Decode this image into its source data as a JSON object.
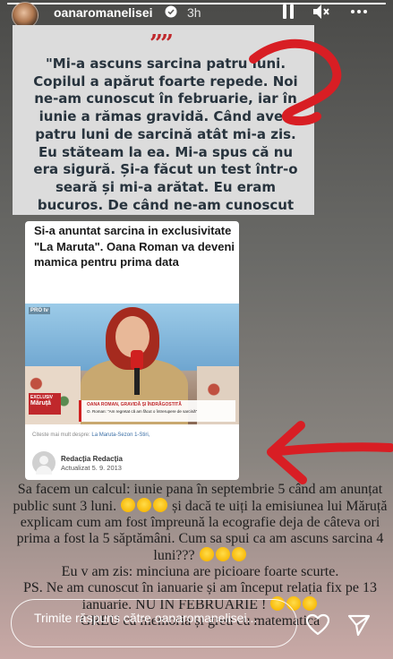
{
  "header": {
    "username": "oanaromanelisei",
    "timestamp": "3h",
    "progress": 1.0
  },
  "quote": {
    "mark": "””",
    "text": "\"Mi-a ascuns sarcina patru luni. Copilul a apărut foarte repede. Noi ne-am cunoscut în februarie, iar în iunie a rămas gravidă. Când avea patru luni de sarcină atât mi-a zis. Eu stăteam la ea. Mi-a spus că nu era sigură. Și-a făcut un test într-o seară și mi-a arătat. Eu eram bucuros. De când ne-am cunoscut"
  },
  "article": {
    "title": "Si-a anuntat sarcina in exclusivitate \"La Maruta\". Oana Roman va deveni mamica pentru prima data",
    "tv_brand": "PRO tv",
    "badge_line1": "EXCLUSIV",
    "badge_line2": "Măruță",
    "lower_third_headline": "OANA ROMAN, GRAVIDĂ ȘI ÎNDRĂGOSTITĂ",
    "lower_third_quote": "O. Roman: \"Am regretat că am făcut o întrerupere de sarcină\"",
    "more_label": "Citeste mai mult despre:",
    "more_tags": "La Maruta-Sezon 1-Stiri,",
    "author": "Redacția Redacția",
    "updated": "Actualizat 5. 9. 2013"
  },
  "caption": {
    "line1a": "Sa facem un calcul: iunie pana în septembrie 5 când am anunțat public sunt 3 luni.",
    "line1b": "și dacă te uiți la emisiunea lui Măruță explicam cum am fost împreună la ecografie deja de câteva ori  prima a fost la 5 săptămâni. Cum sa spui ca am ascuns sarcina 4 luni???",
    "line2": "Eu v am zis: minciuna are picioare foarte scurte.",
    "line3a": "PS. Ne am cunoscut în ianuarie și am început relația fix pe 13 ianuarie. NU IN FEBRUARIE !",
    "line4": "GREU cu memoria și greu cu matematica"
  },
  "reply": {
    "placeholder": "Trimite răspuns către oanaromanelisei..."
  },
  "colors": {
    "accent_red": "#d81e24",
    "quote_text": "#27333d",
    "emoji_yellow": "#f7b500"
  },
  "icons": [
    "pause-icon",
    "mute-icon",
    "more-icon",
    "verified-icon",
    "heart-icon",
    "send-icon"
  ]
}
